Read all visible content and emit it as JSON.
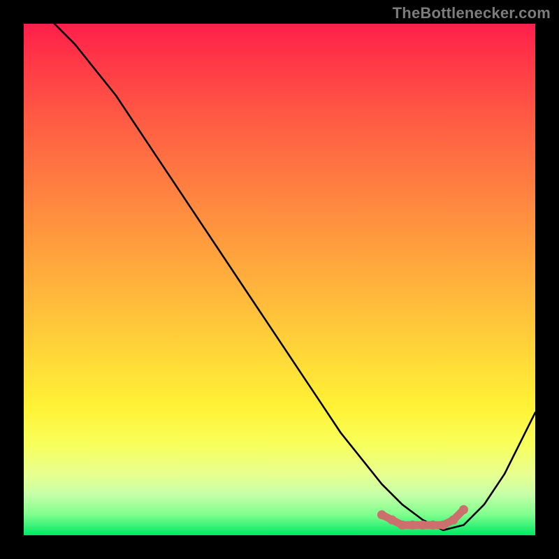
{
  "watermark": "TheBottlenecker.com",
  "chart_data": {
    "type": "line",
    "title": "",
    "xlabel": "",
    "ylabel": "",
    "xlim": [
      0,
      100
    ],
    "ylim": [
      0,
      100
    ],
    "grid": false,
    "background_gradient": [
      "#ff1f4b",
      "#ff7a41",
      "#ffd838",
      "#f8ff5a",
      "#00e765"
    ],
    "series": [
      {
        "name": "bottleneck-curve",
        "color": "#000000",
        "x": [
          6,
          10,
          14,
          18,
          22,
          26,
          30,
          34,
          38,
          42,
          46,
          50,
          54,
          58,
          62,
          66,
          70,
          74,
          78,
          82,
          86,
          90,
          94,
          98,
          100
        ],
        "y": [
          100,
          96,
          91,
          86,
          80,
          74,
          68,
          62,
          56,
          50,
          44,
          38,
          32,
          26,
          20,
          15,
          10,
          6,
          3,
          1,
          2,
          6,
          12,
          20,
          24
        ]
      }
    ],
    "annotations": [
      {
        "name": "optimal-band",
        "type": "marker",
        "color": "#cc6f6d",
        "x": [
          70,
          72,
          74,
          76,
          78,
          80,
          82,
          84,
          86
        ],
        "y": [
          4,
          3,
          2,
          2,
          2,
          2,
          2,
          3,
          5
        ]
      }
    ]
  }
}
